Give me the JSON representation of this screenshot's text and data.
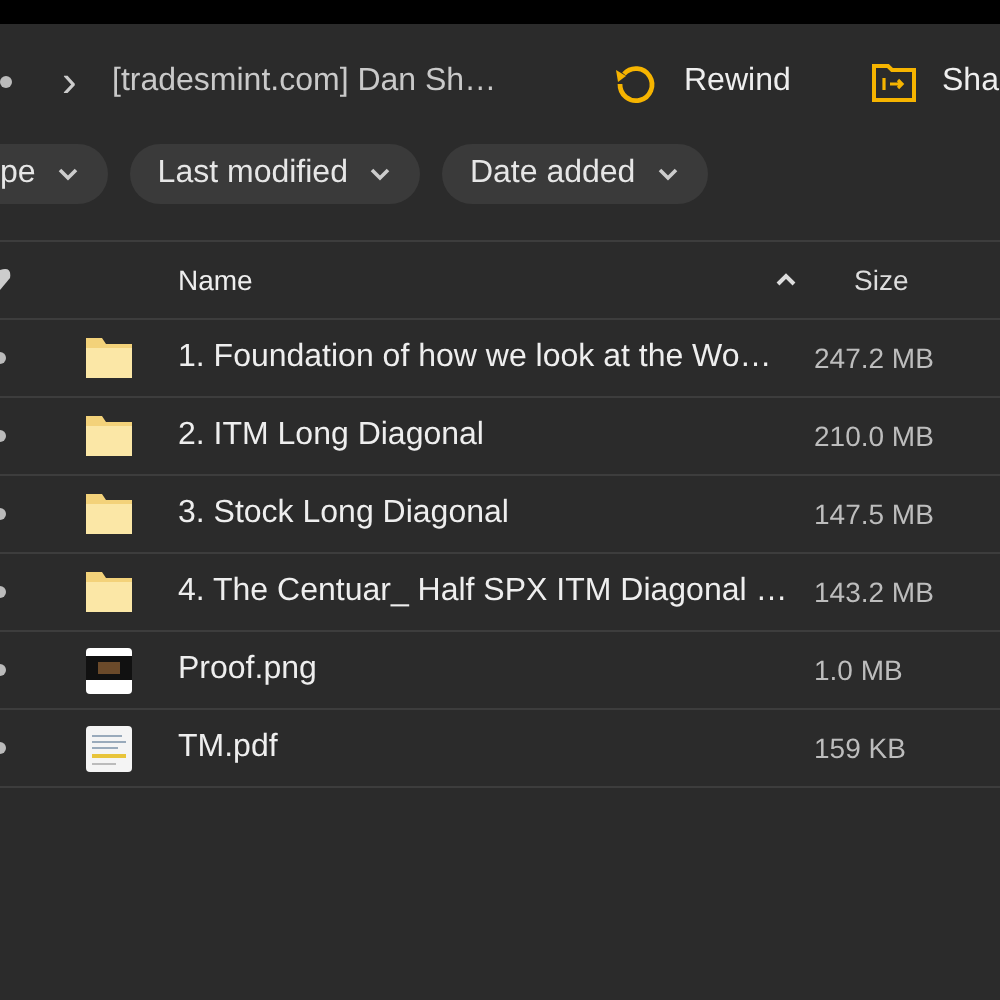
{
  "breadcrumb": {
    "chevron": "›",
    "current": "[tradesmint.com] Dan Sh…"
  },
  "actions": [
    {
      "kind": "rewind",
      "label": "Rewind"
    },
    {
      "kind": "share",
      "label": "Sha"
    }
  ],
  "filters": [
    {
      "label": "pe"
    },
    {
      "label": "Last modified"
    },
    {
      "label": "Date added"
    }
  ],
  "table": {
    "columns": [
      "Name",
      "Size"
    ],
    "sort_ascending": true,
    "rows": [
      {
        "kind": "folder",
        "name": "1. Foundation of how we look at the Wo…",
        "size": "247.2 MB"
      },
      {
        "kind": "folder",
        "name": "2. ITM Long Diagonal",
        "size": "210.0 MB"
      },
      {
        "kind": "folder",
        "name": "3. Stock Long Diagonal",
        "size": "147.5 MB"
      },
      {
        "kind": "folder",
        "name": "4. The Centuar_ Half SPX ITM Diagonal …",
        "size": "143.2 MB"
      },
      {
        "kind": "image",
        "name": "Proof.png",
        "size": "1.0 MB"
      },
      {
        "kind": "pdf",
        "name": "TM.pdf",
        "size": "159 KB"
      }
    ]
  }
}
